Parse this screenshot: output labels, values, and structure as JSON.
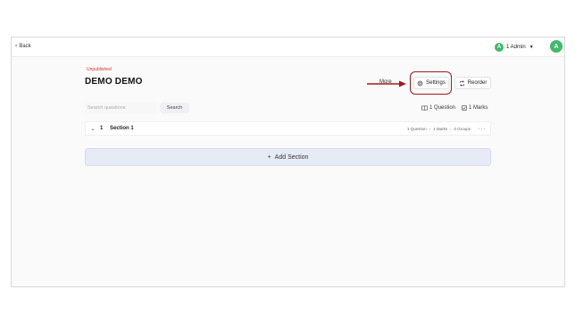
{
  "header": {
    "back_label": "Back",
    "user_initial": "A",
    "user_label": "1 Admin",
    "profile_initial": "A"
  },
  "test": {
    "status": "Unpublished",
    "title": "DEMO DEMO"
  },
  "actions": {
    "more_label": "More",
    "settings_label": "Settings",
    "reorder_label": "Reorder"
  },
  "search": {
    "placeholder": "Search questions",
    "button_label": "Search"
  },
  "stats": {
    "questions": "1 Question",
    "marks": "1 Marks"
  },
  "sections": [
    {
      "number": "1",
      "name": "Section 1",
      "questions": "1 Question",
      "marks": "1 Marks",
      "groups": "0 Groups"
    }
  ],
  "add_section_label": "Add Section",
  "colors": {
    "status_red": "#d0362b",
    "avatar_green": "#3fba6a",
    "highlight": "#9c1c1c",
    "add_section_bg": "#e6ebf6"
  },
  "icons": {
    "back": "chevron-left-icon",
    "settings": "gear-icon",
    "reorder": "reorder-icon",
    "questions": "book-icon",
    "marks": "checkbox-icon",
    "add": "plus-icon"
  }
}
